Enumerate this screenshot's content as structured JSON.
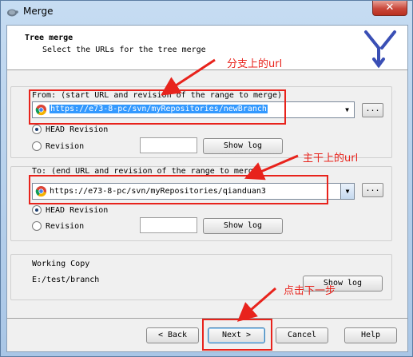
{
  "window": {
    "title": "Merge",
    "close_label": "✕"
  },
  "header": {
    "title": "Tree merge",
    "subtitle": "Select the URLs for the tree merge"
  },
  "from": {
    "label": "From: (start URL and revision of the range to merge)",
    "url": "https://e73-8-pc/svn/myRepositories/newBranch",
    "head_revision_label": "HEAD Revision",
    "revision_label": "Revision",
    "revision_value": "",
    "show_log_label": "Show log",
    "browse_label": "..."
  },
  "to": {
    "label": "To: (end URL and revision of the range to merge)",
    "url": "https://e73-8-pc/svn/myRepositories/qianduan3",
    "head_revision_label": "HEAD Revision",
    "revision_label": "Revision",
    "revision_value": "",
    "show_log_label": "Show log",
    "browse_label": "..."
  },
  "working_copy": {
    "label": "Working Copy",
    "path": "E:/test/branch",
    "show_log_label": "Show log"
  },
  "buttons": {
    "back": "< Back",
    "next": "Next >",
    "cancel": "Cancel",
    "help": "Help"
  },
  "annotations": {
    "branch_url": "分支上的url",
    "trunk_url": "主干上的url",
    "click_next": "点击下一步"
  },
  "colors": {
    "annotation": "#e8231c",
    "selection": "#3399ff",
    "titlebar": "#c6dcf2",
    "close_button": "#c9473a"
  }
}
